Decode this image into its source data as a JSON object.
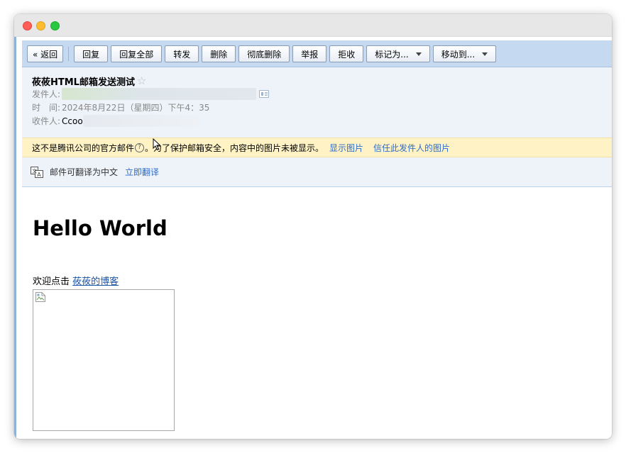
{
  "toolbar": {
    "back_label": "« 返回",
    "buttons": [
      "回复",
      "回复全部",
      "转发",
      "删除",
      "彻底删除",
      "举报",
      "拒收"
    ],
    "mark_as_label": "标记为...",
    "move_to_label": "移动到..."
  },
  "email": {
    "subject": "莜莜HTML邮箱发送测试",
    "star_icon": "star-outline-icon",
    "sender_label": "发件人:",
    "time_label": "时　间:",
    "time_value": "2024年8月22日（星期四）下午4：35",
    "recipient_label": "收件人:",
    "recipient_name": "Ccoo"
  },
  "warning": {
    "text_before": "这不是腾讯公司的官方邮件",
    "help_glyph": "?",
    "text_after": "。为了保护邮箱安全，内容中的图片未被显示。",
    "show_images": "显示图片",
    "trust_sender": "信任此发件人的图片"
  },
  "translate": {
    "icon": "translate-icon",
    "text": "邮件可翻译为中文",
    "action": "立即翻译"
  },
  "body": {
    "heading": "Hello World",
    "welcome_text": "欢迎点击",
    "blog_link": "莜莜的博客",
    "image_icon": "broken-image-icon"
  },
  "colors": {
    "toolbar_bg": "#c5d9f1",
    "header_bg": "#eef3fa",
    "warning_bg": "#fff3c6",
    "link": "#2e6bc9"
  }
}
